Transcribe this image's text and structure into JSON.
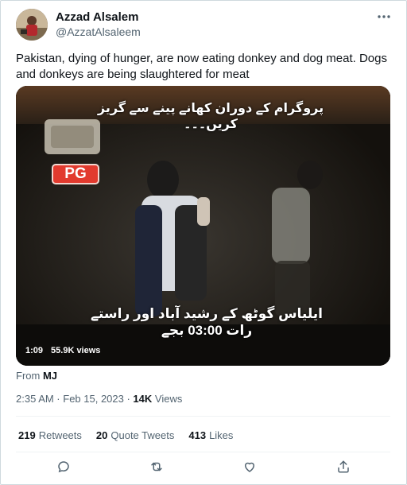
{
  "author": {
    "display_name": "Azzad Alsalem",
    "handle": "@AzzatAlsaleem"
  },
  "tweet": {
    "text": "Pakistan, dying of hunger, are now eating donkey and dog meat. Dogs and donkeys are being slaughtered for meat"
  },
  "media": {
    "badge": "PG",
    "urdu_top": "پروگرام کے دوران کھانے پینے سے گریز کریں۔۔۔",
    "urdu_bottom": "ایلیاس گوٹھ کے رشید آباد اور راستے رات 03:00 بجے",
    "duration": "1:09",
    "views": "55.9K views"
  },
  "source": {
    "prefix": "From",
    "name": "MJ"
  },
  "meta": {
    "timestamp": "2:35 AM · Feb 15, 2023 · ",
    "views_count": "14K",
    "views_label": " Views"
  },
  "stats": {
    "retweets_count": "219",
    "retweets_label": "Retweets",
    "quotes_count": "20",
    "quotes_label": "Quote Tweets",
    "likes_count": "413",
    "likes_label": "Likes"
  },
  "icons": {
    "more": "more-icon",
    "reply": "reply-icon",
    "retweet": "retweet-icon",
    "like": "like-icon",
    "share": "share-icon"
  },
  "colors": {
    "text_primary": "#0f1419",
    "text_secondary": "#536471",
    "border": "#cfd9de",
    "pg_badge": "#e23a2e"
  }
}
